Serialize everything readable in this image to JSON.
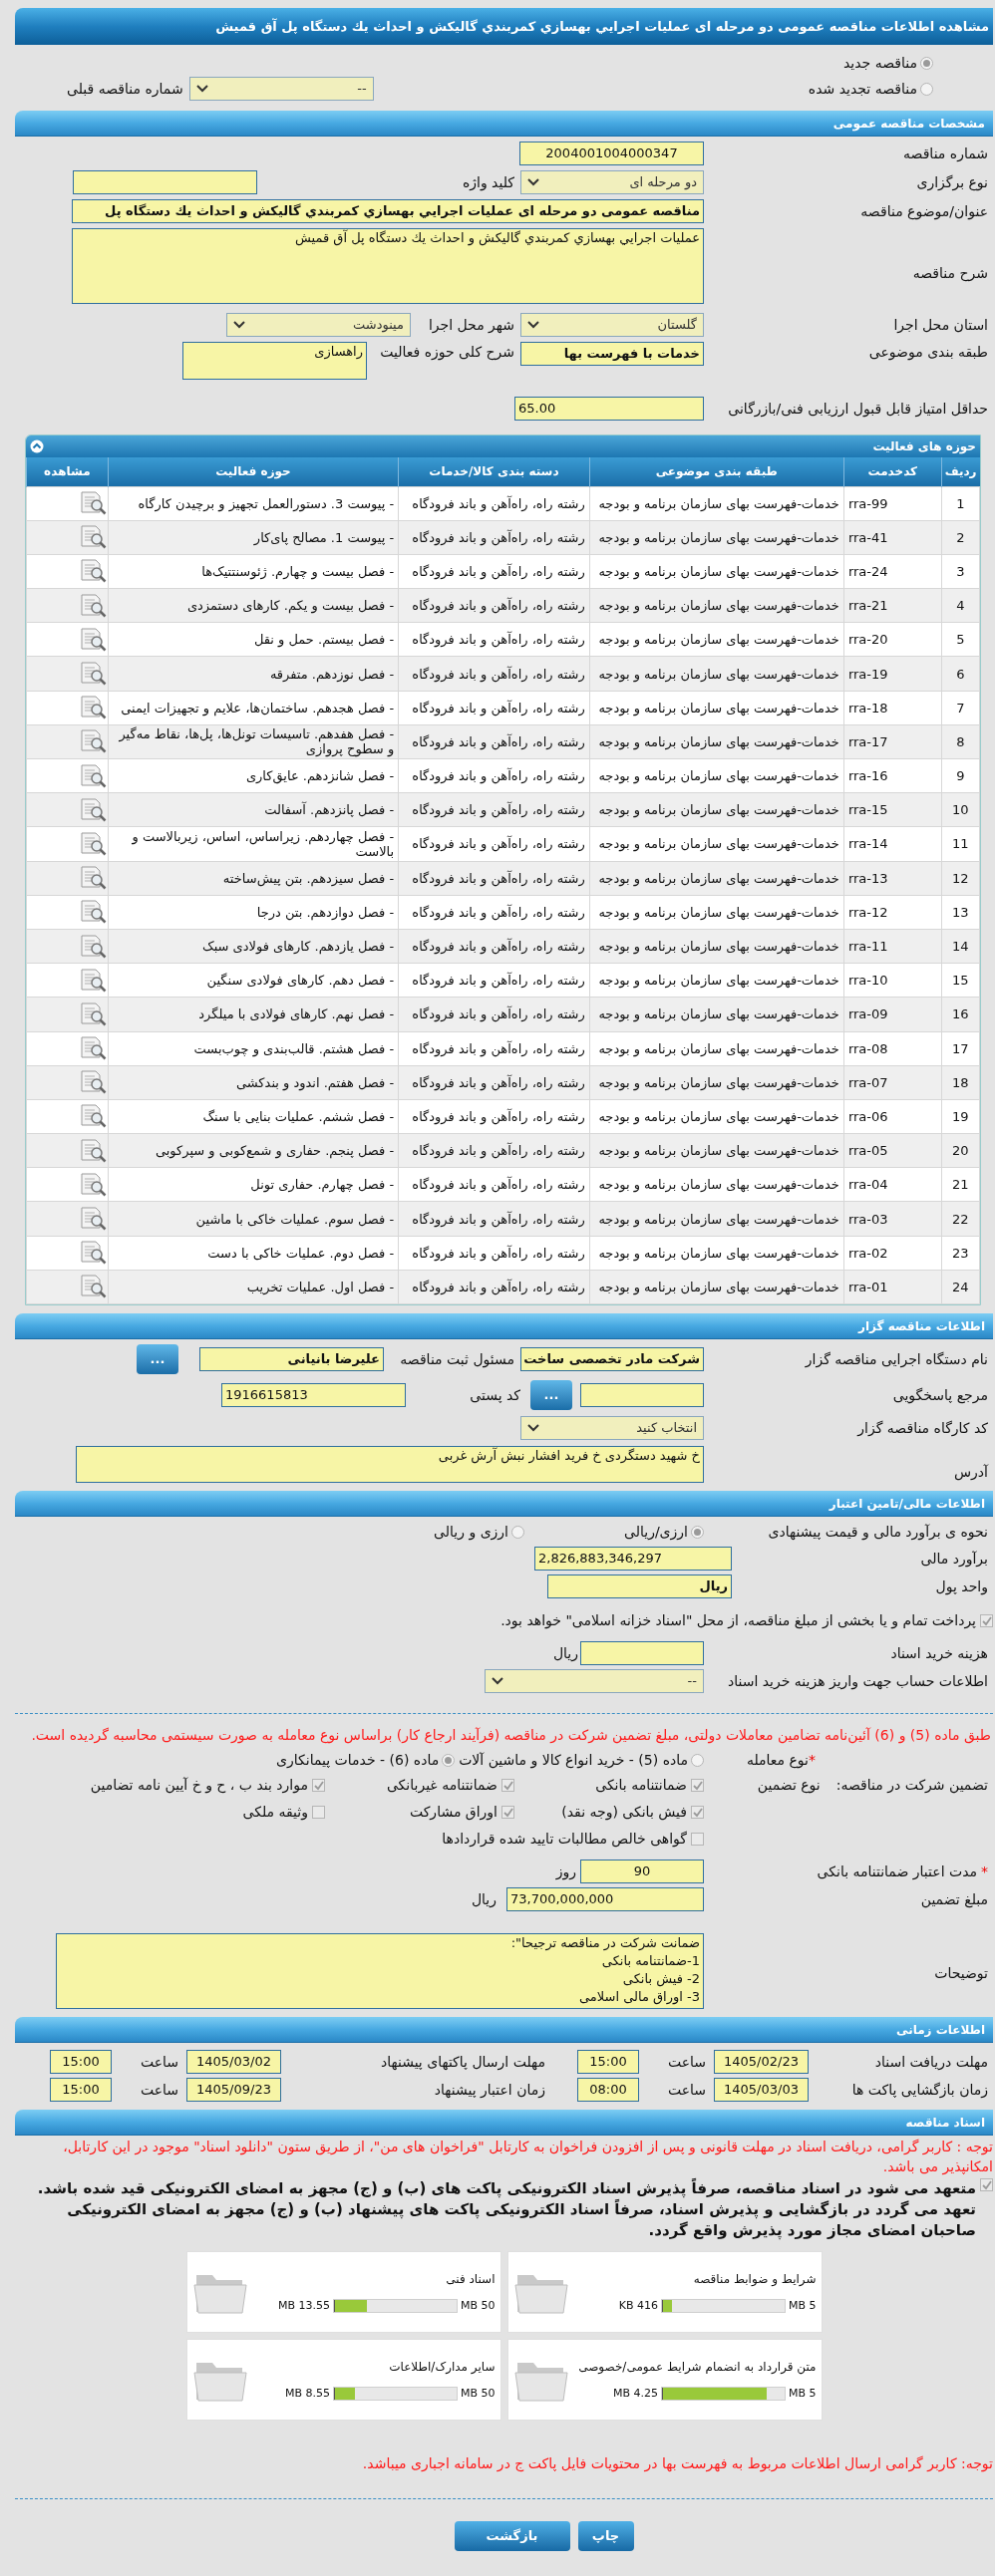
{
  "title": "مشاهده اطلاعات مناقصه عمومی دو مرحله ای عملیات اجرایي بهسازي کمربندي گالیکش و احداث یك دستگاه پل آق قمیش",
  "tender_kind": [
    {
      "label": "مناقصه جدید",
      "selected": true
    },
    {
      "label": "مناقصه تجدید شده",
      "selected": false
    }
  ],
  "previous_number": {
    "label": "شماره مناقصه قبلی",
    "value": "--"
  },
  "general": {
    "header": "مشخصات مناقصه عمومی",
    "number": {
      "label": "شماره مناقصه",
      "value": "2004001004000347"
    },
    "holding_type": {
      "label": "نوع برگزاری",
      "value": "دو مرحله ای"
    },
    "keyword": {
      "label": "کلید واژه"
    },
    "subject": {
      "label": "عنوان/موضوع مناقصه",
      "value": "مناقصه عمومی دو مرحله ای عملیات اجرایي بهسازي کمربندي گالیکش و احداث یك دستگاه پل"
    },
    "description": {
      "label": "شرح مناقصه",
      "value": "عملیات اجرایي بهسازي کمربندي گالیکش و احداث یك دستگاه پل آق قمیش"
    },
    "province": {
      "label": "استان محل اجرا",
      "value": "گلستان"
    },
    "city": {
      "label": "شهر محل اجرا",
      "value": "مینودشت"
    },
    "category": {
      "label": "طبقه بندی موضوعی",
      "value": "خدمات با فهرست بها"
    },
    "activity": {
      "label": "شرح کلی حوزه فعالیت",
      "value": "راهسازی"
    },
    "min_score": {
      "label": "حداقل امتیاز قابل قبول ارزیابی فنی/بازرگانی",
      "value": "65.00"
    }
  },
  "activities": {
    "header": "حوزه های فعالیت",
    "expanded": true,
    "columns": [
      "ردیف",
      "کدخدمت",
      "طبقه بندی موضوعی",
      "دسته بندی کالا/خدمات",
      "حوزه فعالیت",
      "مشاهده"
    ],
    "rows": [
      [
        "1",
        "rra-99",
        "خدمات-فهرست بهای سازمان برنامه و بودجه",
        "رشته راه، راه‌آهن و باند فرودگاه",
        "- پیوست 3. دستورالعمل تجهیز و برچیدن کارگاه"
      ],
      [
        "2",
        "rra-41",
        "خدمات-فهرست بهای سازمان برنامه و بودجه",
        "رشته راه، راه‌آهن و باند فرودگاه",
        "- پیوست 1. مصالح پای‌کار"
      ],
      [
        "3",
        "rra-24",
        "خدمات-فهرست بهای سازمان برنامه و بودجه",
        "رشته راه، راه‌آهن و باند فرودگاه",
        "- فصل بیست و چهارم. ژئوسنتتیک‌ها"
      ],
      [
        "4",
        "rra-21",
        "خدمات-فهرست بهای سازمان برنامه و بودجه",
        "رشته راه، راه‌آهن و باند فرودگاه",
        "- فصل بیست و یکم. کارهای دستمزدی"
      ],
      [
        "5",
        "rra-20",
        "خدمات-فهرست بهای سازمان برنامه و بودجه",
        "رشته راه، راه‌آهن و باند فرودگاه",
        "- فصل بیستم. حمل و نقل"
      ],
      [
        "6",
        "rra-19",
        "خدمات-فهرست بهای سازمان برنامه و بودجه",
        "رشته راه، راه‌آهن و باند فرودگاه",
        "- فصل نوزدهم. متفرقه"
      ],
      [
        "7",
        "rra-18",
        "خدمات-فهرست بهای سازمان برنامه و بودجه",
        "رشته راه، راه‌آهن و باند فرودگاه",
        "- فصل هجدهم. ساختمان‌ها، علایم و تجهیزات ایمنی"
      ],
      [
        "8",
        "rra-17",
        "خدمات-فهرست بهای سازمان برنامه و بودجه",
        "رشته راه، راه‌آهن و باند فرودگاه",
        "- فصل هفدهم. تاسیسات تونل‌ها، پل‌ها، نقاط مه‌گیر و سطوح پروازی"
      ],
      [
        "9",
        "rra-16",
        "خدمات-فهرست بهای سازمان برنامه و بودجه",
        "رشته راه، راه‌آهن و باند فرودگاه",
        "- فصل شانزدهم. عایق‌کاری"
      ],
      [
        "10",
        "rra-15",
        "خدمات-فهرست بهای سازمان برنامه و بودجه",
        "رشته راه، راه‌آهن و باند فرودگاه",
        "- فصل پانزدهم. آسفالت"
      ],
      [
        "11",
        "rra-14",
        "خدمات-فهرست بهای سازمان برنامه و بودجه",
        "رشته راه، راه‌آهن و باند فرودگاه",
        "- فصل چهاردهم. زیراساس، اساس، زیربالاست و بالاست"
      ],
      [
        "12",
        "rra-13",
        "خدمات-فهرست بهای سازمان برنامه و بودجه",
        "رشته راه، راه‌آهن و باند فرودگاه",
        "- فصل سیزدهم. بتن پیش‌ساخته"
      ],
      [
        "13",
        "rra-12",
        "خدمات-فهرست بهای سازمان برنامه و بودجه",
        "رشته راه، راه‌آهن و باند فرودگاه",
        "- فصل دوازدهم. بتن درجا"
      ],
      [
        "14",
        "rra-11",
        "خدمات-فهرست بهای سازمان برنامه و بودجه",
        "رشته راه، راه‌آهن و باند فرودگاه",
        "- فصل یازدهم. کارهای فولادی سبک"
      ],
      [
        "15",
        "rra-10",
        "خدمات-فهرست بهای سازمان برنامه و بودجه",
        "رشته راه، راه‌آهن و باند فرودگاه",
        "- فصل دهم. کارهای فولادی سنگین"
      ],
      [
        "16",
        "rra-09",
        "خدمات-فهرست بهای سازمان برنامه و بودجه",
        "رشته راه، راه‌آهن و باند فرودگاه",
        "- فصل نهم. کارهای فولادی با میلگرد"
      ],
      [
        "17",
        "rra-08",
        "خدمات-فهرست بهای سازمان برنامه و بودجه",
        "رشته راه، راه‌آهن و باند فرودگاه",
        "- فصل هشتم. قالب‌بندی و چوب‌بست"
      ],
      [
        "18",
        "rra-07",
        "خدمات-فهرست بهای سازمان برنامه و بودجه",
        "رشته راه، راه‌آهن و باند فرودگاه",
        "- فصل هفتم. اندود و بندکشی"
      ],
      [
        "19",
        "rra-06",
        "خدمات-فهرست بهای سازمان برنامه و بودجه",
        "رشته راه، راه‌آهن و باند فرودگاه",
        "- فصل ششم. عملیات بنایی با سنگ"
      ],
      [
        "20",
        "rra-05",
        "خدمات-فهرست بهای سازمان برنامه و بودجه",
        "رشته راه، راه‌آهن و باند فرودگاه",
        "- فصل پنجم. حفاری و شمع‌کوبی و سپرکوبی"
      ],
      [
        "21",
        "rra-04",
        "خدمات-فهرست بهای سازمان برنامه و بودجه",
        "رشته راه، راه‌آهن و باند فرودگاه",
        "- فصل چهارم. حفاری تونل"
      ],
      [
        "22",
        "rra-03",
        "خدمات-فهرست بهای سازمان برنامه و بودجه",
        "رشته راه، راه‌آهن و باند فرودگاه",
        "- فصل سوم. عملیات خاکی با ماشین"
      ],
      [
        "23",
        "rra-02",
        "خدمات-فهرست بهای سازمان برنامه و بودجه",
        "رشته راه، راه‌آهن و باند فرودگاه",
        "- فصل دوم. عملیات خاکی با دست"
      ],
      [
        "24",
        "rra-01",
        "خدمات-فهرست بهای سازمان برنامه و بودجه",
        "رشته راه، راه‌آهن و باند فرودگاه",
        "- فصل اول. عملیات تخریب"
      ]
    ]
  },
  "organizer": {
    "header": "اطلاعات مناقصه گزار",
    "org_name": {
      "label": "نام دستگاه اجرایی مناقصه گزار",
      "value": "شرکت مادر تخصصی ساخت"
    },
    "registrar": {
      "label": "مسئول ثبت مناقصه",
      "value": "علیرضا بانیانی",
      "button": "..."
    },
    "reference": {
      "label": "مرجع پاسخگویی",
      "button": "..."
    },
    "postal_code": {
      "label": "کد پستی",
      "value": "1916615813"
    },
    "workshop_code": {
      "label": "کد کارگاه مناقصه گزار",
      "value": "انتخاب کنید"
    },
    "address": {
      "label": "آدرس",
      "value": "خ شهید دستگردی خ فرید افشار نبش آرش غربی"
    }
  },
  "finance": {
    "header": "اطلاعات مالی/تامین اعتبار",
    "estimate_method": {
      "label": "نحوه ی برآورد مالی و قیمت پیشنهادی",
      "options": [
        {
          "label": "ارزی/ریالی",
          "selected": true
        },
        {
          "label": "ارزی و ریالی",
          "selected": false
        }
      ]
    },
    "estimate": {
      "label": "برآورد مالی",
      "value": "2,826,883,346,297"
    },
    "currency": {
      "label": "واحد پول",
      "value": "ریال"
    },
    "treasury": {
      "label": "پرداخت تمام و یا بخشی از مبلغ مناقصه، از محل \"اسناد خزانه اسلامی\" خواهد بود.",
      "checked": true
    },
    "doc_cost": {
      "label": "هزینه خرید اسناد",
      "unit": "ریال"
    },
    "account": {
      "label": "اطلاعات حساب جهت واریز هزینه خرید اسناد",
      "value": "--"
    }
  },
  "guarantee": {
    "notice": "طبق ماده (5) و (6) آئین‌نامه تضامین معاملات دولتی، مبلغ تضمین شرکت در مناقصه (فرآیند ارجاع کار) براساس نوع معامله به صورت سیستمی محاسبه گردیده است.",
    "deal_type": {
      "label": "نوع معامله",
      "required_mark": "*",
      "options": [
        {
          "label": "ماده (5) - خرید انواع کالا و ماشین آلات",
          "selected": false
        },
        {
          "label": "ماده (6) - خدمات پیمانکاری",
          "selected": true
        }
      ]
    },
    "participation_label": "تضمین شرکت در مناقصه:",
    "type_label": "نوع تضمین",
    "types": [
      {
        "label": "ضمانتنامه بانکی",
        "checked": true
      },
      {
        "label": "ضمانتنامه غیربانکی",
        "checked": true
      },
      {
        "label": "موارد بند ب ، ح و خ آیین نامه تضامین",
        "checked": true
      },
      {
        "label": "فیش بانکی (وجه نقد)",
        "checked": true
      },
      {
        "label": "اوراق مشارکت",
        "checked": true
      },
      {
        "label": "وثیقه ملکی",
        "checked": false
      },
      {
        "label": "گواهی خالص مطالبات تایید شده قراردادها",
        "checked": false
      }
    ],
    "validity": {
      "label": "مدت اعتبار ضمانتنامه بانکی",
      "required_mark": "*",
      "value": "90",
      "unit": "روز"
    },
    "amount": {
      "label": "مبلغ تضمین",
      "value": "73,700,000,000",
      "unit": "ریال"
    },
    "notes": {
      "label": "توضیحات",
      "lines": [
        "ضمانت شرکت در مناقصه ترجیحا\":",
        "1-ضمانتنامه بانکی",
        "2- فیش بانکی",
        "3- اوراق مالی اسلامی"
      ]
    }
  },
  "timing": {
    "header": "اطلاعات زمانی",
    "rows": [
      [
        {
          "label": "مهلت دریافت اسناد",
          "date": "1405/02/23",
          "time_label": "ساعت",
          "time": "15:00"
        },
        {
          "label": "مهلت ارسال پاکتهای پیشنهاد",
          "date": "1405/03/02",
          "time_label": "ساعت",
          "time": "15:00"
        }
      ],
      [
        {
          "label": "زمان بازگشایی پاکت ها",
          "date": "1405/03/03",
          "time_label": "ساعت",
          "time": "08:00"
        },
        {
          "label": "زمان اعتبار پیشنهاد",
          "date": "1405/09/23",
          "time_label": "ساعت",
          "time": "15:00"
        }
      ]
    ]
  },
  "documents": {
    "header": "اسناد مناقصه",
    "notice": "توجه : کاربر گرامی، دریافت اسناد در مهلت قانونی و پس از افزودن فراخوان به کارتابل \"فراخوان های من\"، از طریق ستون \"دانلود اسناد\" موجود در این کارتابل، امکانپذیر می باشد.",
    "commitment": {
      "label": "متعهد می شود در اسناد مناقصه، صرفاً پذیرش اسناد الکترونیکی پاکت های (ب) و (ج) مجهز به امضای الکترونیکی قید شده باشد. تعهد می گردد در بازگشایی و پذیرش اسناد، صرفاً اسناد الکترونیکی پاکت های پیشنهاد (ب) و (ج) مجهز به امضای الکترونیکی صاحبان امضای مجاز مورد پذیرش واقع گردد.",
      "checked": true
    },
    "files": [
      {
        "name": "شرایط و ضوابط مناقصه",
        "size": "416 KB",
        "max": "5 MB",
        "level": 0.08
      },
      {
        "name": "اسناد فنی",
        "size": "13.55 MB",
        "max": "50 MB",
        "level": 0.27
      },
      {
        "name": "متن قرارداد به انضمام شرایط عمومی/خصوصی",
        "size": "4.25 MB",
        "max": "5 MB",
        "level": 0.85
      },
      {
        "name": "سایر مدارک/اطلاعات",
        "size": "8.55 MB",
        "max": "50 MB",
        "level": 0.17
      }
    ],
    "footer_notice": "توجه: کاربر گرامی ارسال اطلاعات مربوط به فهرست بها در محتویات فایل پاکت ج در سامانه اجباری میباشد."
  },
  "buttons": [
    {
      "label": "چاپ"
    },
    {
      "label": "بازگشت"
    }
  ]
}
